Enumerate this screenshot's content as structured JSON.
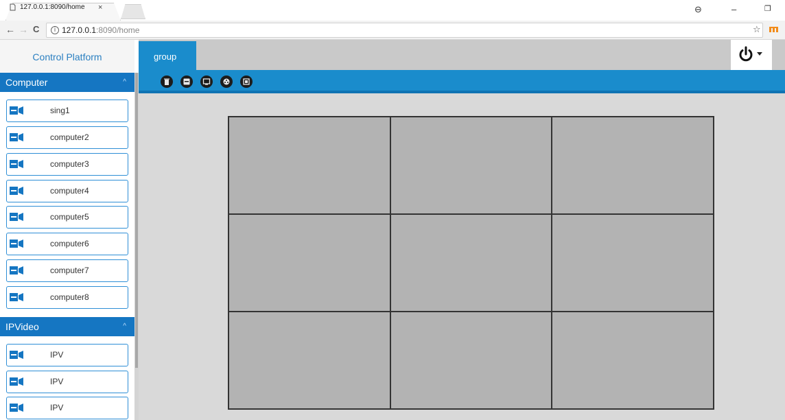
{
  "browser": {
    "tab_title": "127.0.0.1:8090/home",
    "tab_close": "×",
    "url_host": "127.0.0.1",
    "url_path": ":8090/home",
    "back": "←",
    "forward": "→",
    "reload": "C",
    "star": "☆",
    "account": "⊖",
    "minimize": "–",
    "restore": "❐"
  },
  "sidebar": {
    "title": "Control Platform",
    "groups": [
      {
        "name": "Computer",
        "collapse_glyph": "^",
        "items": [
          "sing1",
          "computer2",
          "computer3",
          "computer4",
          "computer5",
          "computer6",
          "computer7",
          "computer8"
        ]
      },
      {
        "name": "IPVideo",
        "collapse_glyph": "^",
        "items": [
          "IPV",
          "IPV",
          "IPV"
        ]
      }
    ]
  },
  "main": {
    "active_tab": "group",
    "toolbar_icons": [
      "delete-icon",
      "save-icon",
      "screen-icon",
      "film-icon",
      "display-icon"
    ],
    "wall": {
      "rows": 3,
      "cols": 3
    }
  },
  "colors": {
    "accent": "#1576c2",
    "toolbar_blue": "#1a8ccc",
    "screen_fill": "#b3b3b3",
    "content_bg": "#d9d9d9"
  }
}
